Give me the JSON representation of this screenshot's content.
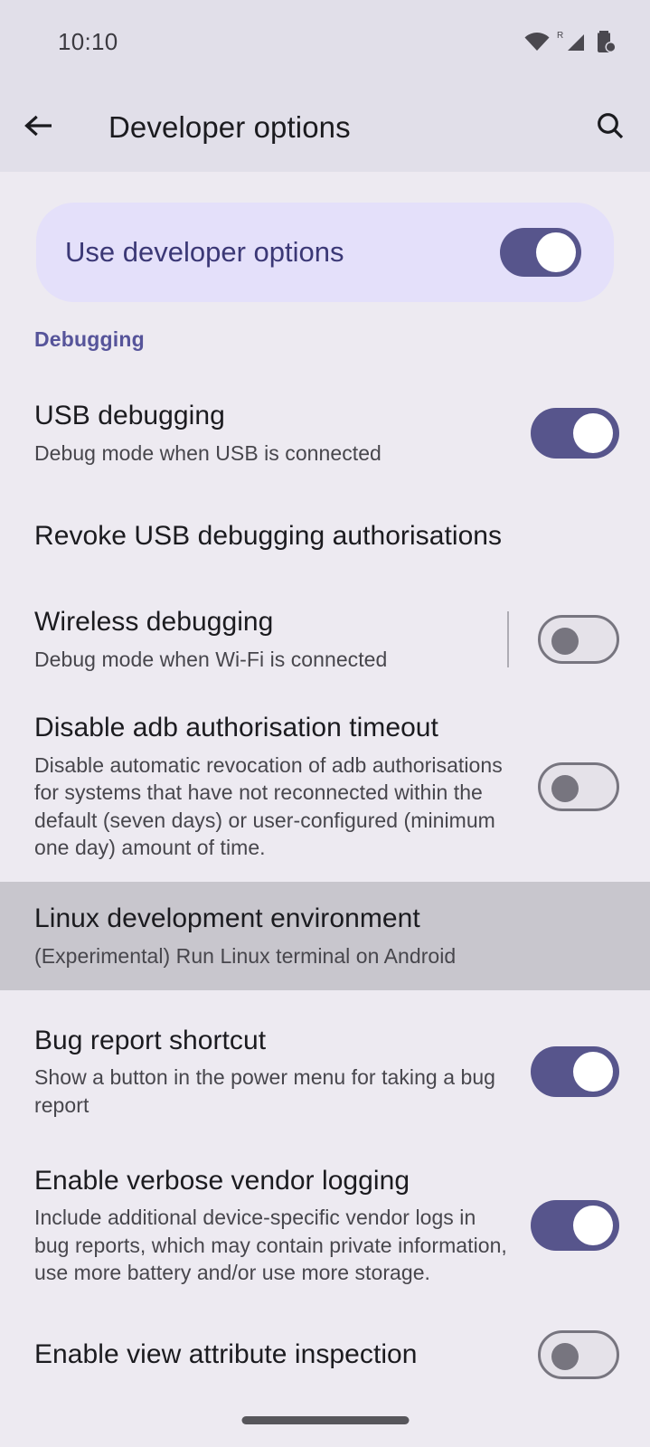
{
  "status_bar": {
    "time": "10:10",
    "icons": [
      "wifi-icon",
      "roaming-signal-icon",
      "battery-icon"
    ],
    "roaming_label": "R"
  },
  "app_bar": {
    "back_icon": "back-arrow-icon",
    "title": "Developer options",
    "search_icon": "search-icon"
  },
  "master_toggle": {
    "label": "Use developer options",
    "state": "on"
  },
  "sections": [
    {
      "header": "Debugging"
    }
  ],
  "rows": [
    {
      "title": "USB debugging",
      "subtitle": "Debug mode when USB is connected",
      "control": "switch",
      "state": "on",
      "divider": false
    },
    {
      "title": "Revoke USB debugging authorisations",
      "subtitle": "",
      "control": "none",
      "state": "",
      "divider": false
    },
    {
      "title": "Wireless debugging",
      "subtitle": "Debug mode when Wi-Fi is connected",
      "control": "switch",
      "state": "off",
      "divider": true
    },
    {
      "title": "Disable adb authorisation timeout",
      "subtitle": "Disable automatic revocation of adb authorisations for systems that have not reconnected within the default (seven days) or user-configured (minimum one day) amount of time.",
      "control": "switch",
      "state": "off",
      "divider": false
    },
    {
      "title": "Linux development environment",
      "subtitle": "(Experimental) Run Linux terminal on Android",
      "control": "none",
      "state": "",
      "divider": false,
      "highlighted": true
    },
    {
      "title": "Bug report shortcut",
      "subtitle": "Show a button in the power menu for taking a bug report",
      "control": "switch",
      "state": "on",
      "divider": false
    },
    {
      "title": "Enable verbose vendor logging",
      "subtitle": "Include additional device-specific vendor logs in bug reports, which may contain private information, use more battery and/or use more storage.",
      "control": "switch",
      "state": "on",
      "divider": false
    },
    {
      "title": "Enable view attribute inspection",
      "subtitle": "",
      "control": "switch",
      "state": "off",
      "divider": false
    }
  ],
  "navigation": {
    "home_pill": "home-gesture-pill"
  },
  "colors": {
    "accent_purple": "#56549A",
    "switch_on": "#57558C",
    "card_background": "#E4E0FA",
    "app_bar_background": "#E1DFE9",
    "page_background": "#EDEAF1",
    "highlight_row": "#C8C6CD",
    "title_text": "#1B1B1F",
    "subtitle_text": "#47464C"
  }
}
